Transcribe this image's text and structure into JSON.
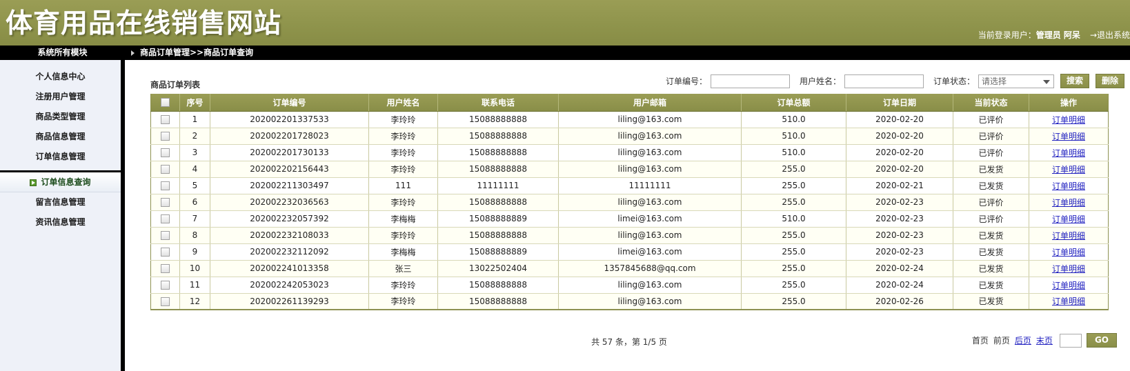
{
  "banner": {
    "site_title": "体育用品在线销售网站",
    "user_prefix": "当前登录用户：",
    "user_name": "管理员 阿呆",
    "logout": "→退出系统"
  },
  "nav": {
    "modules_label": "系统所有模块",
    "breadcrumb": "商品订单管理>>商品订单查询"
  },
  "sidebar": {
    "items": [
      {
        "label": "个人信息中心",
        "active": false
      },
      {
        "label": "注册用户管理",
        "active": false
      },
      {
        "label": "商品类型管理",
        "active": false
      },
      {
        "label": "商品信息管理",
        "active": false
      },
      {
        "label": "订单信息管理",
        "active": false
      },
      {
        "label": "订单信息查询",
        "active": true
      },
      {
        "label": "留言信息管理",
        "active": false
      },
      {
        "label": "资讯信息管理",
        "active": false
      }
    ]
  },
  "main": {
    "list_title": "商品订单列表"
  },
  "search": {
    "order_no_label": "订单编号：",
    "order_no_value": "",
    "user_name_label": "用户姓名：",
    "user_name_value": "",
    "status_label": "订单状态：",
    "status_selected": "请选择",
    "search_button": "搜索",
    "delete_button": "删除"
  },
  "table": {
    "headers": [
      "",
      "序号",
      "订单编号",
      "用户姓名",
      "联系电话",
      "用户邮箱",
      "订单总额",
      "订单日期",
      "当前状态",
      "操作"
    ],
    "action_label": "订单明细",
    "rows": [
      {
        "idx": "1",
        "order_no": "202002201337533",
        "user": "李玲玲",
        "tel": "15088888888",
        "email": "liling@163.com",
        "amount": "510.0",
        "date": "2020-02-20",
        "status": "已评价"
      },
      {
        "idx": "2",
        "order_no": "202002201728023",
        "user": "李玲玲",
        "tel": "15088888888",
        "email": "liling@163.com",
        "amount": "510.0",
        "date": "2020-02-20",
        "status": "已评价"
      },
      {
        "idx": "3",
        "order_no": "202002201730133",
        "user": "李玲玲",
        "tel": "15088888888",
        "email": "liling@163.com",
        "amount": "510.0",
        "date": "2020-02-20",
        "status": "已评价"
      },
      {
        "idx": "4",
        "order_no": "202002202156443",
        "user": "李玲玲",
        "tel": "15088888888",
        "email": "liling@163.com",
        "amount": "255.0",
        "date": "2020-02-20",
        "status": "已发货"
      },
      {
        "idx": "5",
        "order_no": "202002211303497",
        "user": "111",
        "tel": "11111111",
        "email": "11111111",
        "amount": "255.0",
        "date": "2020-02-21",
        "status": "已发货"
      },
      {
        "idx": "6",
        "order_no": "202002232036563",
        "user": "李玲玲",
        "tel": "15088888888",
        "email": "liling@163.com",
        "amount": "255.0",
        "date": "2020-02-23",
        "status": "已评价"
      },
      {
        "idx": "7",
        "order_no": "202002232057392",
        "user": "李梅梅",
        "tel": "15088888889",
        "email": "limei@163.com",
        "amount": "510.0",
        "date": "2020-02-23",
        "status": "已评价"
      },
      {
        "idx": "8",
        "order_no": "202002232108033",
        "user": "李玲玲",
        "tel": "15088888888",
        "email": "liling@163.com",
        "amount": "255.0",
        "date": "2020-02-23",
        "status": "已发货"
      },
      {
        "idx": "9",
        "order_no": "202002232112092",
        "user": "李梅梅",
        "tel": "15088888889",
        "email": "limei@163.com",
        "amount": "255.0",
        "date": "2020-02-23",
        "status": "已发货"
      },
      {
        "idx": "10",
        "order_no": "202002241013358",
        "user": "张三",
        "tel": "13022502404",
        "email": "1357845688@qq.com",
        "amount": "255.0",
        "date": "2020-02-24",
        "status": "已发货"
      },
      {
        "idx": "11",
        "order_no": "202002242053023",
        "user": "李玲玲",
        "tel": "15088888888",
        "email": "liling@163.com",
        "amount": "255.0",
        "date": "2020-02-24",
        "status": "已发货"
      },
      {
        "idx": "12",
        "order_no": "202002261139293",
        "user": "李玲玲",
        "tel": "15088888888",
        "email": "liling@163.com",
        "amount": "255.0",
        "date": "2020-02-26",
        "status": "已发货"
      }
    ]
  },
  "pager": {
    "summary": "共 57 条，第 1/5 页",
    "first": "首页",
    "prev": "前页",
    "next": "后页",
    "last": "末页",
    "page_input": "",
    "go": "GO"
  }
}
